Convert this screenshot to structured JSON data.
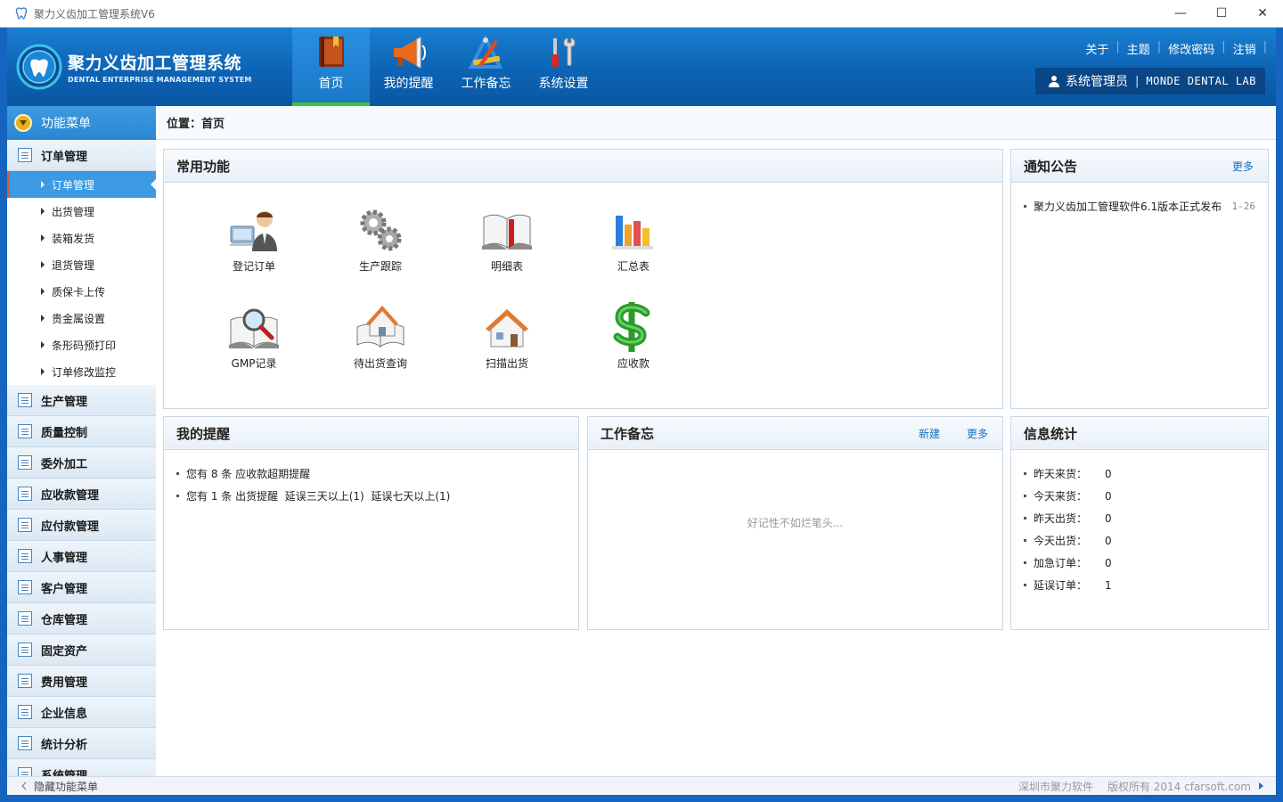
{
  "window": {
    "title": "聚力义齿加工管理系统V6",
    "minimize": "—",
    "maximize": "☐",
    "close": "✕"
  },
  "brand": {
    "name_cn": "聚力义齿加工管理系统",
    "name_en": "DENTAL ENTERPRISE MANAGEMENT SYSTEM"
  },
  "nav": [
    {
      "label": "首页",
      "icon": "book-icon",
      "active": true
    },
    {
      "label": "我的提醒",
      "icon": "megaphone-icon"
    },
    {
      "label": "工作备忘",
      "icon": "ruler-pencil-icon"
    },
    {
      "label": "系统设置",
      "icon": "tools-icon"
    }
  ],
  "toplinks": [
    "关于",
    "主题",
    "修改密码",
    "注销"
  ],
  "user": {
    "name": "系统管理员",
    "separator": "|",
    "company": "MONDE DENTAL LAB"
  },
  "sidebar": {
    "title": "功能菜单",
    "order_group": "订单管理",
    "order_items": [
      "订单管理",
      "出货管理",
      "装箱发货",
      "退货管理",
      "质保卡上传",
      "贵金属设置",
      "条形码预打印",
      "订单修改监控"
    ],
    "groups": [
      "生产管理",
      "质量控制",
      "委外加工",
      "应收款管理",
      "应付款管理",
      "人事管理",
      "客户管理",
      "仓库管理",
      "固定资产",
      "费用管理",
      "企业信息",
      "统计分析",
      "系统管理"
    ]
  },
  "breadcrumb": "位置：首页",
  "common": {
    "title": "常用功能",
    "items": [
      {
        "label": "登记订单",
        "icon": "user-computer-icon"
      },
      {
        "label": "生产跟踪",
        "icon": "gears-icon"
      },
      {
        "label": "明细表",
        "icon": "open-book-icon"
      },
      {
        "label": "汇总表",
        "icon": "bar-chart-icon"
      },
      {
        "label": "GMP记录",
        "icon": "magnifier-book-icon"
      },
      {
        "label": "待出货查询",
        "icon": "house-book-icon"
      },
      {
        "label": "扫描出货",
        "icon": "house-icon"
      },
      {
        "label": "应收款",
        "icon": "dollar-icon"
      }
    ]
  },
  "notice": {
    "title": "通知公告",
    "more": "更多",
    "items": [
      {
        "text": "聚力义齿加工管理软件6.1版本正式发布",
        "date": "1-26"
      }
    ]
  },
  "reminder": {
    "title": "我的提醒",
    "items": [
      "您有 8 条 应收款超期提醒",
      "您有 1 条 出货提醒  延误三天以上(1)  延误七天以上(1)"
    ]
  },
  "memo": {
    "title": "工作备忘",
    "new": "新建",
    "more": "更多",
    "empty": "好记性不如烂笔头..."
  },
  "stats": {
    "title": "信息统计",
    "items": [
      {
        "label": "昨天来货：",
        "value": "0"
      },
      {
        "label": "今天来货：",
        "value": "0"
      },
      {
        "label": "昨天出货：",
        "value": "0"
      },
      {
        "label": "今天出货：",
        "value": "0"
      },
      {
        "label": "加急订单：",
        "value": "0"
      },
      {
        "label": "延误订单：",
        "value": "1"
      }
    ]
  },
  "statusbar": {
    "hide_menu": "隐藏功能菜单",
    "company": "深圳市聚力软件",
    "copyright": "版权所有 2014 cfarsoft.com"
  },
  "colors": {
    "header": "#0d63b4",
    "accent": "#3b9ae2",
    "active_bar": "#46c23a",
    "link": "#1a6fbf"
  }
}
